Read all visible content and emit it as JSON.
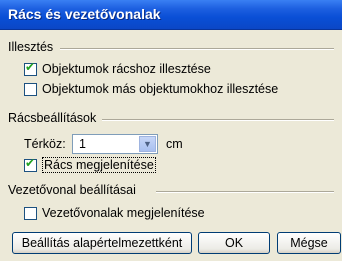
{
  "window": {
    "title": "Rács és vezetővonalak"
  },
  "alignment": {
    "label": "Illesztés",
    "options": [
      {
        "label": "Objektumok rácshoz illesztése",
        "checked": true
      },
      {
        "label": "Objektumok más objektumokhoz illesztése",
        "checked": false
      }
    ]
  },
  "grid": {
    "label": "Rácsbeállítások",
    "spacing_label": "Térköz:",
    "spacing_value": "1",
    "unit": "cm",
    "show_grid": {
      "label": "Rács megjelenítése",
      "checked": true
    }
  },
  "guides": {
    "label": "Vezetővonal beállításai",
    "show_guides": {
      "label": "Vezetővonalak megjelenítése",
      "checked": false
    }
  },
  "buttons": {
    "default": "Beállítás alapértelmezettként",
    "ok": "OK",
    "cancel": "Mégse"
  },
  "colors": {
    "titlebar": "#0a4fd6",
    "dialog_bg": "#ece9d8",
    "check": "#21a121"
  },
  "icons": {
    "checkmark": "check-icon",
    "dropdown": "chevron-down-icon"
  }
}
